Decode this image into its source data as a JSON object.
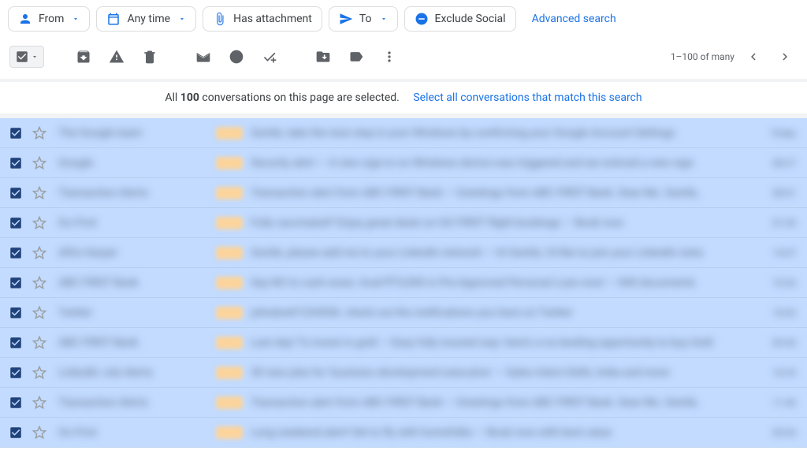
{
  "filters": {
    "from": "From",
    "anytime": "Any time",
    "attachment": "Has attachment",
    "to": "To",
    "exclude": "Exclude Social",
    "advanced": "Advanced search"
  },
  "pager": {
    "range": "1–100 of many"
  },
  "banner": {
    "prefix": "All ",
    "count": "100",
    "suffix": " conversations on this page are selected.",
    "link": "Select all conversations that match this search"
  },
  "rows": [
    {
      "sender": "The Google team",
      "subject": "Gentle, take the next step in your Windows by confirming your Google Account Settings",
      "time": "Today"
    },
    {
      "sender": "Google",
      "subject": "Security alert — A new sign-in on Windows device was triggered and we noticed a new sign",
      "time": "08:27"
    },
    {
      "sender": "Transaction Alerts",
      "subject": "Transaction alert from ABC FIRST Bank — Greetings from ABC FIRST Bank. Dear Ms. Gentle,",
      "time": "08:01"
    },
    {
      "sender": "Go First",
      "subject": "Fully vaccinated? Enjoy great deals on GO FIRST flight bookings — Book now",
      "time": "07:45"
    },
    {
      "sender": "Alfre Harper",
      "subject": "Gentle, please add me to your LinkedIn network — Hi Gentle, I'd like to join your LinkedIn netw",
      "time": "14:07"
    },
    {
      "sender": "ABC FIRST Bank",
      "subject": "Say NO to cash woes: Avail ₹73,000 in Pre-Approved Personal Loan now! — 840 documents",
      "time": "10:26"
    },
    {
      "sender": "Twitter",
      "subject": "johndoe01234556: check out the notifications you have on Twitter",
      "time": "10:02"
    },
    {
      "sender": "ABC FIRST Bank",
      "subject": "Last day! To invest in gold — Easy fully insured way: here's a no-landing opportunity to buy Gold",
      "time": "09:45"
    },
    {
      "sender": "LinkedIn Job Alerts",
      "subject": "30 new jobs for 'business development executive' — Sales Intern Delhi, India and more",
      "time": "16:29"
    },
    {
      "sender": "Transaction Alerts",
      "subject": "Transaction alert from ABC FIRST Bank — Greetings from ABC FIRST Bank. Dear Ms. Gentle,",
      "time": "11:46"
    },
    {
      "sender": "Go First",
      "subject": "Long weekend alert! Set to fly with homefolks — Book now with best value",
      "time": "09:04"
    }
  ]
}
